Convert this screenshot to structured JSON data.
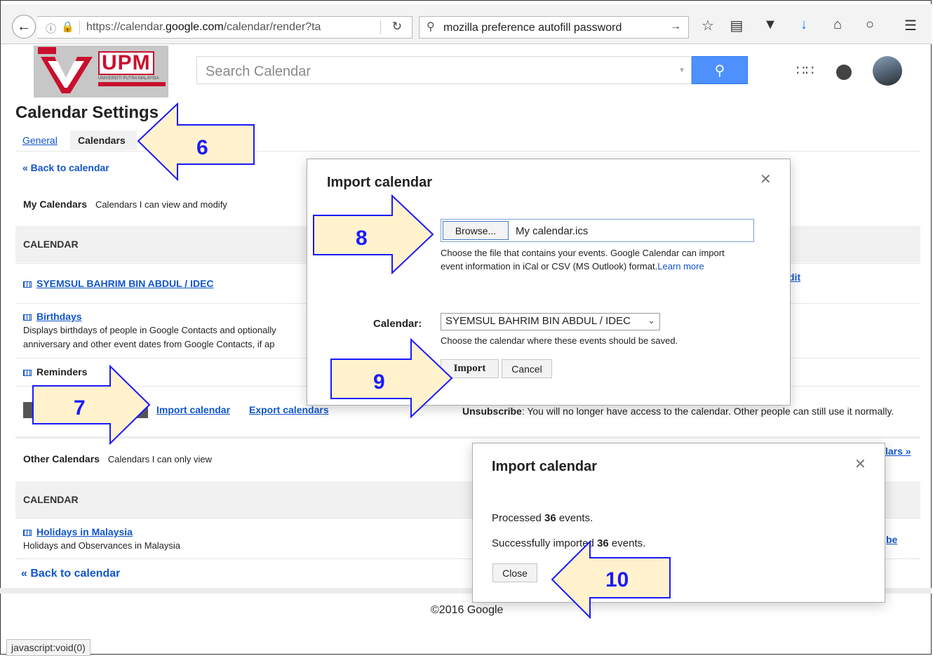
{
  "browser": {
    "url_prefix": "https://calendar.",
    "url_domain": "google.com",
    "url_suffix": "/calendar/render?ta",
    "search_query": "mozilla preference autofill password",
    "status_text": "javascript:void(0)"
  },
  "header": {
    "logo_text": "UPM",
    "logo_sub": "UNIVERSITI PUTRA MALAYSIA",
    "search_placeholder": "Search Calendar"
  },
  "settings": {
    "title": "Calendar Settings",
    "tabs": [
      "General",
      "Calendars"
    ],
    "back_link": "« Back to calendar",
    "my_calendars_label": "My Calendars",
    "my_calendars_desc": "Calendars I can view and modify",
    "section_header": "CALENDAR",
    "my_calendar_list": [
      {
        "name": "SYEMSUL BAHRIM BIN ABDUL / IDEC",
        "desc": ""
      },
      {
        "name": "Birthdays",
        "desc": "Displays birthdays of people in Google Contacts and optionally",
        "desc2": "anniversary and other event dates from Google Contacts, if ap"
      }
    ],
    "reminders_label": "Reminders",
    "import_link": "Import calendar",
    "export_link": "Export calendars",
    "unsubscribe_label": "Unsubscribe",
    "unsubscribe_text": ": You will no longer have access to the calendar. Other people can still use it normally.",
    "edit_fragment": "dit",
    "other_calendars_label": "Other Calendars",
    "other_calendars_desc": "Calendars I can only view",
    "browse_fragment": "lars »",
    "other_list": [
      {
        "name": "Holidays in Malaysia",
        "desc": "Holidays and Observances in Malaysia"
      }
    ],
    "be_fragment": "be",
    "footer": "©2016 Google"
  },
  "import_dialog": {
    "title": "Import calendar",
    "browse_label": "Browse...",
    "file_name": "My calendar.ics",
    "help_text": "Choose the file that contains your events. Google Calendar can import",
    "help_text2": "event information in iCal or CSV (MS Outlook) format.",
    "learn_more": "Learn more",
    "calendar_label": "Calendar:",
    "calendar_selected": "SYEMSUL BAHRIM BIN ABDUL / IDEC",
    "calendar_help": "Choose the calendar where these events should be saved.",
    "import_button": "Import",
    "cancel_button": "Cancel"
  },
  "result_dialog": {
    "title": "Import calendar",
    "processed_prefix": "Processed ",
    "processed_count": "36",
    "processed_suffix": " events.",
    "success_prefix": "Successfully imported ",
    "success_count": "36",
    "success_suffix": " events.",
    "close_button": "Close"
  },
  "callouts": [
    "6",
    "7",
    "8",
    "9",
    "10"
  ],
  "colors": {
    "arrow_fill": "#fff2cc",
    "arrow_stroke": "#1a1aff",
    "accent": "#4d90fe",
    "link": "#1155cc"
  }
}
